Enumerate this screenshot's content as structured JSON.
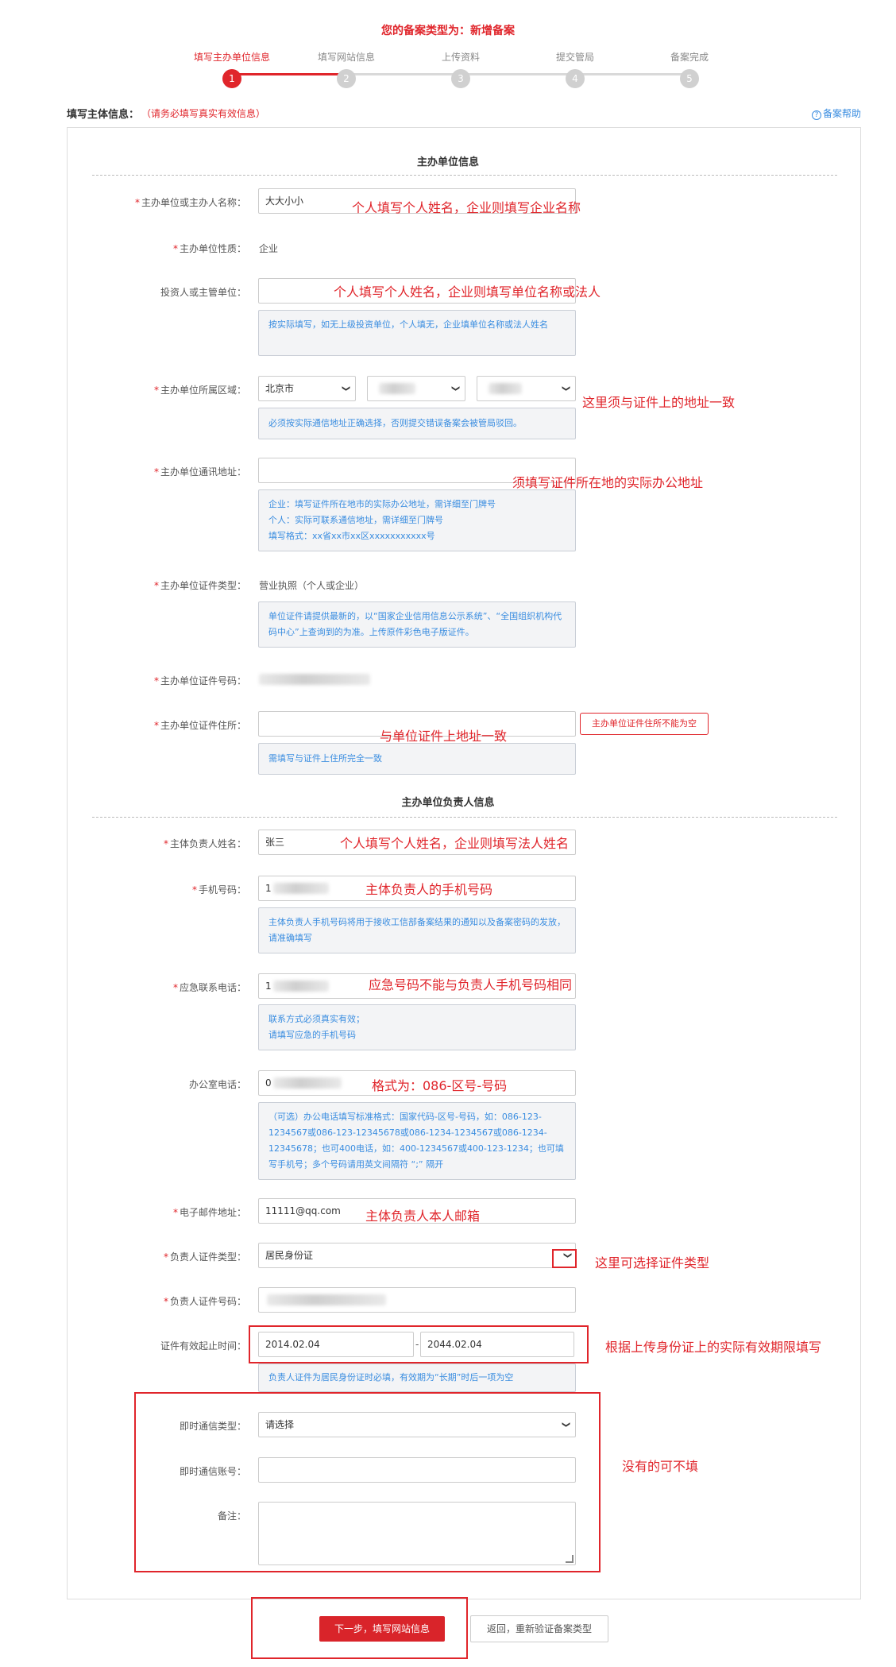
{
  "header": {
    "type_line": "您的备案类型为：新增备案"
  },
  "steps": [
    {
      "label": "填写主办单位信息",
      "num": "1"
    },
    {
      "label": "填写网站信息",
      "num": "2"
    },
    {
      "label": "上传资料",
      "num": "3"
    },
    {
      "label": "提交管局",
      "num": "4"
    },
    {
      "label": "备案完成",
      "num": "5"
    }
  ],
  "form_head": {
    "title": "填写主体信息：",
    "note": "（请务必填写真实有效信息）",
    "help": "备案帮助"
  },
  "section1": {
    "title": "主办单位信息"
  },
  "section2": {
    "title": "主办单位负责人信息"
  },
  "fields": {
    "name": {
      "label": "主办单位或主办人名称：",
      "value": "大大小小"
    },
    "nature": {
      "label": "主办单位性质：",
      "value": "企业"
    },
    "investor": {
      "label": "投资人或主管单位：",
      "value": "",
      "tip": "按实际填写，如无上级投资单位，个人填无，企业填单位名称或法人姓名"
    },
    "region": {
      "label": "主办单位所属区域：",
      "province": "北京市",
      "tip": "必须按实际通信地址正确选择，否则提交错误备案会被管局驳回。"
    },
    "address": {
      "label": "主办单位通讯地址：",
      "value": "",
      "tip1": "企业：填写证件所在地市的实际办公地址，需详细至门牌号",
      "tip2": "个人：实际可联系通信地址，需详细至门牌号",
      "tip3": "填写格式：xx省xx市xx区xxxxxxxxxxx号"
    },
    "cert_type": {
      "label": "主办单位证件类型：",
      "value": "营业执照（个人或企业）",
      "tip": "单位证件请提供最新的，以“国家企业信用信息公示系统”、“全国组织机构代码中心”上查询到的为准。上传原件彩色电子版证件。"
    },
    "cert_no": {
      "label": "主办单位证件号码："
    },
    "cert_addr": {
      "label": "主办单位证件住所：",
      "value": "",
      "error": "主办单位证件住所不能为空",
      "tip": "需填写与证件上住所完全一致"
    },
    "person_name": {
      "label": "主体负责人姓名：",
      "value": "张三"
    },
    "mobile": {
      "label": "手机号码：",
      "value": "1",
      "tip": "主体负责人手机号码将用于接收工信部备案结果的通知以及备案密码的发放，请准确填写"
    },
    "emergency": {
      "label": "应急联系电话：",
      "value": "1",
      "tip1": "联系方式必须真实有效；",
      "tip2": "请填写应急的手机号码"
    },
    "office": {
      "label": "办公室电话：",
      "value": "0",
      "tip": "（可选）办公电话填写标准格式：国家代码-区号-号码，如：086-123-1234567或086-123-12345678或086-1234-1234567或086-1234-12345678；也可400电话，如：400-1234567或400-123-1234；也可填写手机号；多个号码请用英文间隔符 “;” 隔开"
    },
    "email": {
      "label": "电子邮件地址：",
      "value": "11111@qq.com"
    },
    "id_type": {
      "label": "负责人证件类型：",
      "value": "居民身份证"
    },
    "id_no": {
      "label": "负责人证件号码："
    },
    "validity": {
      "label": "证件有效起止时间：",
      "start": "2014.02.04",
      "end": "2044.02.04",
      "sep": "-",
      "tip": "负责人证件为居民身份证时必填，有效期为“长期”时后一项为空"
    },
    "im_type": {
      "label": "即时通信类型：",
      "value": "请选择"
    },
    "im_account": {
      "label": "即时通信账号：",
      "value": ""
    },
    "remark": {
      "label": "备注："
    }
  },
  "annotations": {
    "a1": "个人填写个人姓名，企业则填写企业名称",
    "a2": "个人填写个人姓名，企业则填写单位名称或法人",
    "a3": "这里须与证件上的地址一致",
    "a4": "须填写证件所在地的实际办公地址",
    "a5": "与单位证件上地址一致",
    "a6": "个人填写个人姓名，企业则填写法人姓名",
    "a7": "主体负责人的手机号码",
    "a8": "应急号码不能与负责人手机号码相同",
    "a9": "格式为：086-区号-号码",
    "a10": "主体负责人本人邮箱",
    "a11": "这里可选择证件类型",
    "a12": "根据上传身份证上的实际有效期限填写",
    "a13": "没有的可不填"
  },
  "buttons": {
    "next": "下一步，填写网站信息",
    "back": "返回，重新验证备案类型"
  },
  "colors": {
    "accent": "#e0252b",
    "tip_text": "#3a8de0",
    "tip_bg": "#f3f4f6"
  }
}
